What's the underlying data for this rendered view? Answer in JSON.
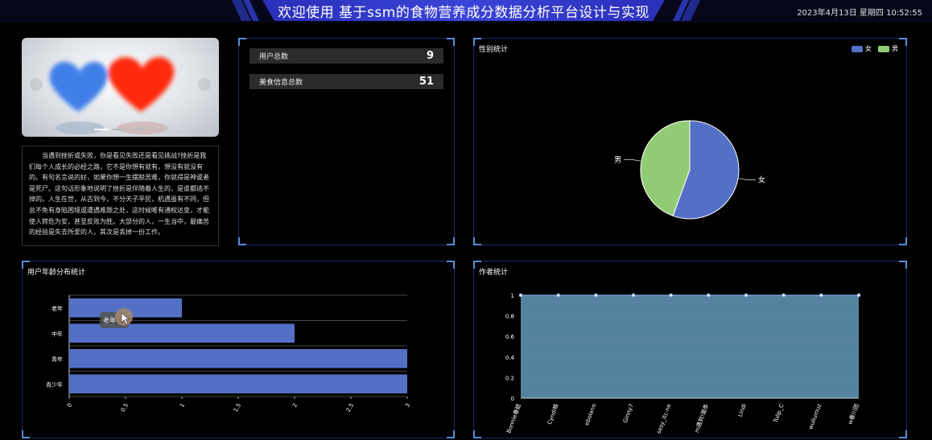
{
  "header": {
    "title": "欢迎使用 基于ssm的食物营养成分数据分析平台设计与实现",
    "datetime": "2023年4月13日 星期四 10:52:55"
  },
  "article": {
    "text": "当遇到挫折或失败，你是看见失败还是看见挑战?挫折是我们每个人成长的必经之路，它不是你想有就有，想没有就没有的。有句名言说的好，如果你想一生摆脱苦难，你就得是神或者是死尸。这句话形象地说明了挫折是伴随着人生的，是谁都逃不掉的。人生在世，从古到今，不分天子平民，机遇虽有不同，但总不免有身陷困境或遭遇难题之处，这时候唯有通权达变，才能使人转危为安，甚至反败为胜。大部分的人，一生当中，最痛苦的经验是失去所爱的人，其次是丢掉一份工作。"
  },
  "stats": [
    {
      "label": "用户总数",
      "value": "9"
    },
    {
      "label": "美食信息总数",
      "value": "51"
    }
  ],
  "colors": {
    "blue": "#5470c6",
    "green": "#91cc75",
    "border": "#1a2a66",
    "corner": "#5b8bd8",
    "area": "#5a89a8"
  },
  "gender_chart": {
    "title": "性别统计",
    "chart_data": {
      "type": "pie",
      "labels": [
        "女",
        "男"
      ],
      "values": [
        5,
        4
      ],
      "legend_position": "top-right"
    }
  },
  "age_chart": {
    "title": "用户年龄分布统计",
    "tooltip": "老年",
    "chart_data": {
      "type": "bar",
      "orientation": "horizontal",
      "categories": [
        "老年",
        "中年",
        "青年",
        "青少年"
      ],
      "values": [
        1,
        2,
        3,
        3
      ],
      "xticks": [
        "0",
        "0.5",
        "1",
        "1.5",
        "2",
        "2.5",
        "3"
      ],
      "xlim": [
        0,
        3
      ]
    }
  },
  "author_chart": {
    "title": "作者统计",
    "chart_data": {
      "type": "area",
      "categories": [
        "Bonnie春姐",
        "Cyndi格",
        "ebolano",
        "Ginny7",
        "sesy_itc-ne",
        "m遇到!面条",
        "Lindi",
        "Tulip_C",
        "wuliumuz",
        "w春川团"
      ],
      "values": [
        1,
        1,
        1,
        1,
        1,
        1,
        1,
        1,
        1,
        1
      ],
      "yticks": [
        "0",
        "0.2",
        "0.4",
        "0.6",
        "0.8",
        "1"
      ],
      "ylim": [
        0,
        1
      ]
    }
  }
}
